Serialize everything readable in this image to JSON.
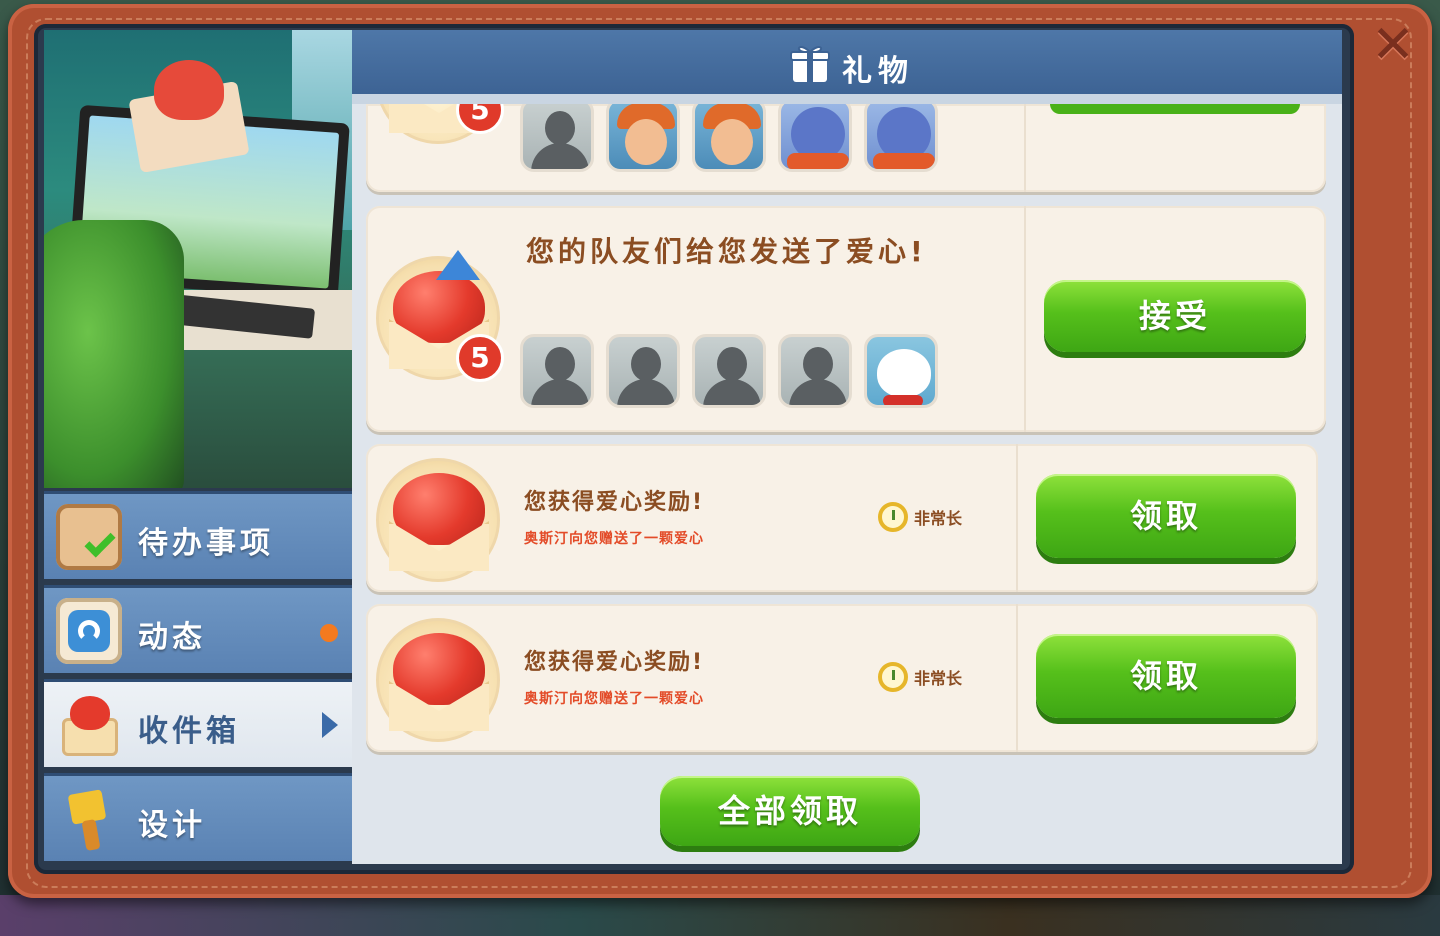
{
  "header": {
    "title": "礼物",
    "icon": "gift-icon"
  },
  "sidebar": {
    "items": [
      {
        "label": "待办事项",
        "icon": "clipboard-check-icon",
        "active": false
      },
      {
        "label": "动态",
        "icon": "activity-feed-icon",
        "active": false,
        "has_notification": true
      },
      {
        "label": "收件箱",
        "icon": "heart-envelope-icon",
        "active": true
      },
      {
        "label": "设计",
        "icon": "paint-brush-icon",
        "active": false
      }
    ]
  },
  "gifts": [
    {
      "badge": "5",
      "avatars": [
        "silhouette",
        "boy",
        "boy",
        "bird",
        "bird"
      ]
    },
    {
      "title": "您的队友们给您发送了爱心!",
      "badge": "5",
      "avatars": [
        "silhouette",
        "silhouette",
        "silhouette",
        "silhouette",
        "cat"
      ],
      "button": "接受"
    },
    {
      "title": "您获得爱心奖励!",
      "subtitle": "奥斯汀向您赠送了一颗爱心",
      "time": "非常长",
      "button": "领取"
    },
    {
      "title": "您获得爱心奖励!",
      "subtitle": "奥斯汀向您赠送了一颗爱心",
      "time": "非常长",
      "button": "领取"
    }
  ],
  "footer": {
    "claim_all": "全部领取"
  },
  "colors": {
    "frame": "#b04f31",
    "header": "#4e77a8",
    "button_green": "#56c01b",
    "title_brown": "#8b4d22",
    "subtitle_red": "#e34b28",
    "badge_red": "#e03a2a"
  }
}
